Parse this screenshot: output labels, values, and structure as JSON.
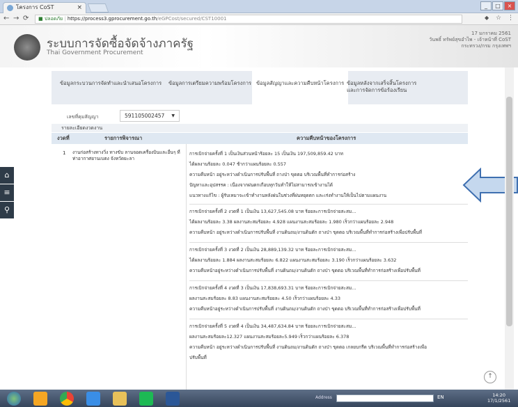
{
  "browser": {
    "tab_title": "โครงการ CoST",
    "url_lock": "ปลอดภัย",
    "url_host": "https://process3.gprocurement.go.th",
    "url_path": "/eGPCost/secured/CST10001"
  },
  "header": {
    "title": "ระบบการจัดซื้อจัดจ้างภาครัฐ",
    "subtitle": "Thai Government Procurement",
    "date": "17 มกราคม 2561",
    "user": "วันพธิ์ ทรัพย์สุขอำไพ - เจ้าหน้าที่ CoST",
    "agency": "กระทรวง/กรม กรุงเทพฯ"
  },
  "tabs": [
    {
      "label": "ข้อมูลกระบวนการจัดทำและนำเสนอโครงการ"
    },
    {
      "label": "ข้อมูลการเตรียมความพร้อมโครงการ"
    },
    {
      "label": "ข้อมูลสัญญาและความคืบหน้าโครงการ"
    },
    {
      "label": "ข้อมูลหลังจากเสร็จสิ้นโครงการ"
    },
    {
      "label": "และการจัดการข้อร้องเรียน"
    }
  ],
  "contract": {
    "label": "เลขที่คุมสัญญา",
    "value": "591105002457"
  },
  "section_title": "รายละเอียดงวดงาน",
  "table": {
    "col_no": "งวดที่",
    "col_item": "รายการพิจารณา",
    "col_progress": "ความคืบหน้าของโครงการ"
  },
  "row": {
    "no": "1",
    "desc": "งานก่อสร้างทางวิ่ง ทางขับ ลานจอดเครื่องบินและอื่นๆ ที่ท่าอากาศยานเบตง จังหวัดยะลา"
  },
  "entries": [
    [
      "การเบิกจ่ายครั้งที่ 1 เป็นเงินส่วนหน้าร้อยละ 15 เป็นเงิน 197,509,859.42 บาท",
      "ได้ผลงานร้อยละ 0.047 ช้ากว่าแผนร้อยละ 0.557",
      "ความคืบหน้า อยู่ระหว่างดำเนินการปรับพื้นที่ ถางป่า ขุดตอ บริเวณพื้นที่ทำการก่อสร้าง",
      "ปัญหาและอุปสรรค : เนื่องจากฝนตกเกือบทุกวันทำให้ไม่สามารถเข้างานได้",
      "แนวทางแก้ไข : ผู้รับเหมาจะเข้าทำงานหลังฝนในช่วงที่ฝนหยุดตก และเร่งทำงานให้เป็นไปตามแผนงาน"
    ],
    [
      "การเบิกจ่ายครั้งที่ 2 งวดที่ 1 เป็นเงิน 13,627,545.08 บาท ร้อยละการเบิกจ่ายสะสม...",
      "ได้ผลงานร้อยละ 3.38 ผลงานสะสมร้อยละ 4.928 แผนงานสะสมร้อยละ 1.980 เร็วกว่าแผนร้อยละ 2.948",
      "ความคืบหน้า อยู่ระหว่างดำเนินการปรับพื้นที่ งานดินถม/งานดินตัก ถางป่า ขุดตอ บริเวณพื้นที่ทำการก่อสร้างเพื่อปรับพื้นที่"
    ],
    [
      "การเบิกจ่ายครั้งที่ 3 งวดที่ 2 เป็นเงิน 28,889,139.32 บาท ร้อยละการเบิกจ่ายสะสม...",
      "ได้ผลงานร้อยละ 1.884 ผลงานสะสมร้อยละ 6.822 แผนงานสะสมร้อยละ 3.190 เร็วกว่าแผนร้อยละ 3.632",
      "ความคืบหน้าอยู่ระหว่างดำเนินการปรับพื้นที่ งานดินถม/งานดินตัก ถางป่า ขุดตอ บริเวณพื้นที่ทำการก่อสร้างเพื่อปรับพื้นที่"
    ],
    [
      "การเบิกจ่ายครั้งที่ 4 งวดที่ 3 เป็นเงิน 17,838,693.31 บาท ร้อยละการเบิกจ่ายสะสม...",
      "ผลงานสะสมร้อยละ 8.83 แผนงานสะสมร้อยละ 4.50 เร็วกว่าแผนร้อยละ 4.33",
      "ความคืบหน้าอยู่ระหว่างดำเนินการปรับพื้นที่ งานดินถม/งานดินตัก ถางป่า ขุดตอ บริเวณพื้นที่ทำการก่อสร้างเพื่อปรับพื้นที่"
    ],
    [
      "การเบิกจ่ายครั้งที่ 5 งวดที่ 4 เป็นเงิน 34,487,634.84 บาท ร้อยละการเบิกจ่ายสะสม...",
      "ผลงานสะสมร้อยละ12.327 แผนงานสะสมร้อยละ5.949 เร็วกว่าแผนร้อยละ 6.378",
      "ความคืบหน้า อยู่ระหว่างดำเนินการปรับพื้นที่ งานดินถม/งานดินตัก ถางป่า ขุดตอ เกลยบกรีด บริเวณพื้นที่ทำการก่อสร้างเพื่อ",
      "ปรับพื้นที่"
    ]
  ],
  "taskbar": {
    "address_label": "Address",
    "clock_time": "14:20",
    "clock_date": "17/1/2561",
    "lang": "EN"
  },
  "colors": {
    "nav_dark": "#2e3b48",
    "arrow_fill": "#c5d8ee",
    "arrow_stroke": "#3e6fb0"
  },
  "icons": [
    "home-icon",
    "menu-icon",
    "search-icon",
    "scroll-top-icon"
  ]
}
